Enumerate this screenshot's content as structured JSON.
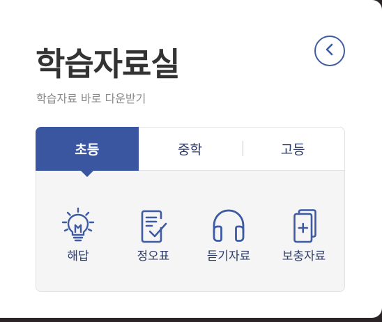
{
  "header": {
    "title": "학습자료실",
    "subtitle": "학습자료 바로 다운받기"
  },
  "tabs": [
    {
      "label": "초등",
      "active": true
    },
    {
      "label": "중학",
      "active": false
    },
    {
      "label": "고등",
      "active": false
    }
  ],
  "items": [
    {
      "label": "해답",
      "icon": "lightbulb-icon"
    },
    {
      "label": "정오표",
      "icon": "checked-document-icon"
    },
    {
      "label": "듣기자료",
      "icon": "headphones-icon"
    },
    {
      "label": "보충자료",
      "icon": "stacked-documents-plus-icon"
    }
  ],
  "colors": {
    "accent": "#3a56a0",
    "icon": "#3d5aa3",
    "label": "#2d3d6e"
  }
}
